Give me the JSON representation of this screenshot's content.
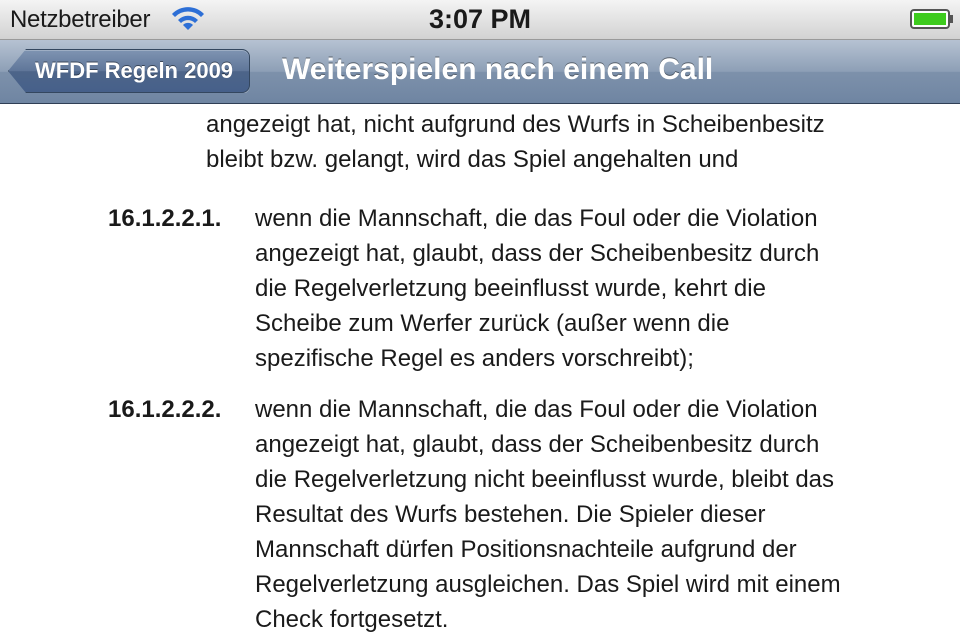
{
  "status_bar": {
    "carrier": "Netzbetreiber",
    "time": "3:07 PM",
    "wifi_icon": "wifi-icon",
    "battery_icon": "battery-icon",
    "battery_color": "#3ecb1e"
  },
  "nav_bar": {
    "back_label": "WFDF Regeln 2009",
    "title": "Weiterspielen nach einem Call"
  },
  "content": {
    "intro_lines": [
      "angezeigt hat, nicht aufgrund des Wurfs in Scheibenbesitz",
      "bleibt bzw. gelangt, wird das Spiel angehalten und"
    ],
    "rules": [
      {
        "number": "16.1.2.2.1.",
        "lines": [
          "wenn die Mannschaft, die das Foul oder die Violation",
          "angezeigt hat, glaubt, dass der Scheibenbesitz durch",
          "die Regelverletzung beeinflusst wurde, kehrt die",
          "Scheibe zum Werfer zurück (außer wenn die",
          "spezifische Regel es anders vorschreibt);"
        ]
      },
      {
        "number": "16.1.2.2.2.",
        "lines": [
          "wenn die Mannschaft, die das Foul oder die Violation",
          "angezeigt hat, glaubt, dass der Scheibenbesitz durch",
          "die Regelverletzung nicht beeinflusst wurde, bleibt das",
          "Resultat des Wurfs bestehen. Die Spieler dieser",
          "Mannschaft dürfen Positionsnachteile aufgrund der",
          "Regelverletzung ausgleichen. Das Spiel wird mit einem",
          "Check fortgesetzt."
        ]
      }
    ]
  }
}
